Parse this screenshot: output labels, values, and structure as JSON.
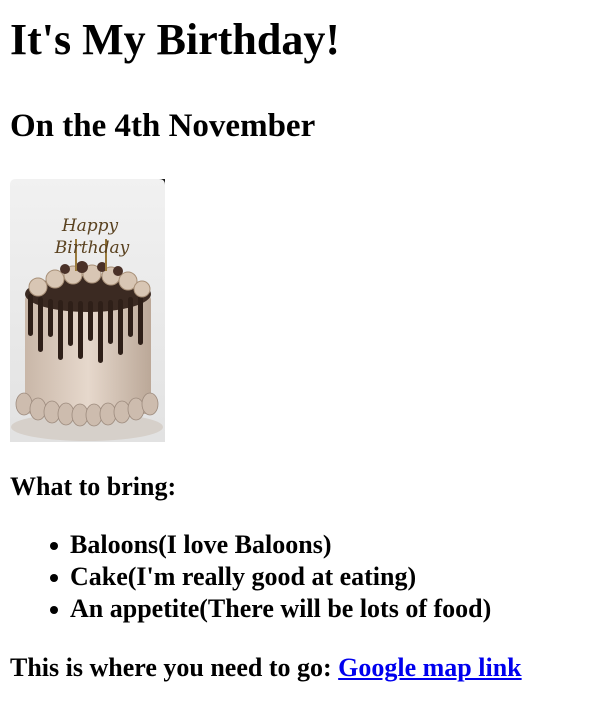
{
  "heading": {
    "title": "It's My Birthday!",
    "subtitle": "On the 4th November"
  },
  "image": {
    "topper_text_1": "Happy",
    "topper_text_2": "Birthday"
  },
  "bring": {
    "label": "What to bring:",
    "items": [
      "Baloons(I love Baloons)",
      "Cake(I'm really good at eating)",
      "An appetite(There will be lots of food)"
    ]
  },
  "directions": {
    "text": "This is where you need to go:",
    "link_text": "Google map link"
  },
  "colors": {
    "link": "#0000ee",
    "text": "#000000",
    "background": "#ffffff"
  }
}
